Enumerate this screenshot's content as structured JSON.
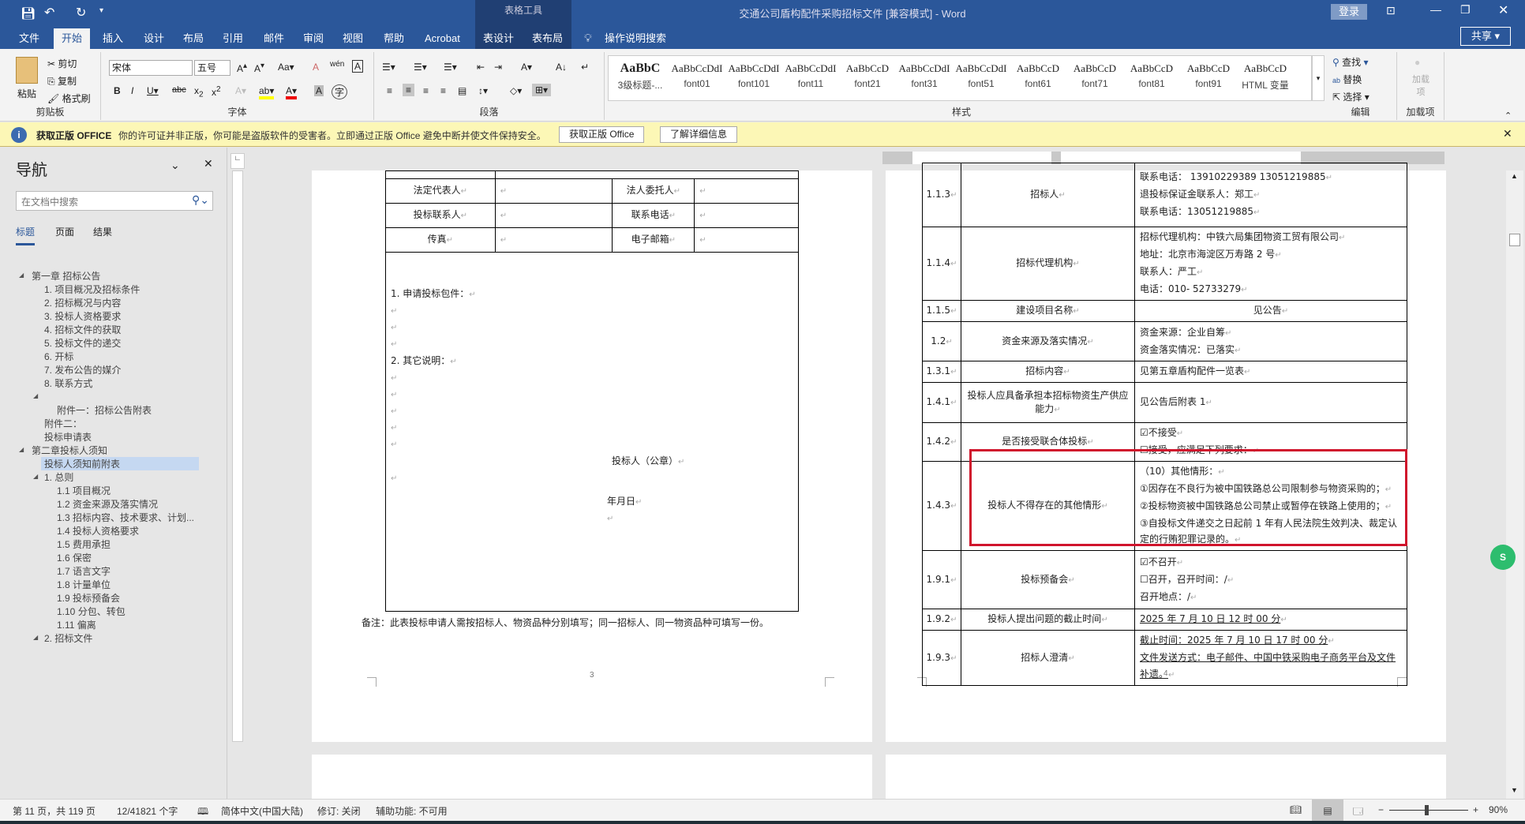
{
  "titlebar": {
    "title": "交通公司盾构配件采购招标文件 [兼容模式] - Word",
    "context_tab": "表格工具",
    "login": "登录",
    "share": "共享"
  },
  "tabs": [
    "文件",
    "开始",
    "插入",
    "设计",
    "布局",
    "引用",
    "邮件",
    "审阅",
    "视图",
    "帮助",
    "Acrobat",
    "表设计",
    "表布局"
  ],
  "tell_me": "操作说明搜索",
  "ribbon": {
    "clipboard": {
      "paste": "粘贴",
      "cut": "剪切",
      "copy": "复制",
      "format_painter": "格式刷",
      "label": "剪贴板"
    },
    "font": {
      "name": "宋体",
      "size": "五号",
      "label": "字体"
    },
    "paragraph": {
      "label": "段落"
    },
    "styles": {
      "label": "样式",
      "items": [
        {
          "preview": "AaBbC",
          "name": "3级标题-..."
        },
        {
          "preview": "AaBbCcDdI",
          "name": "font01"
        },
        {
          "preview": "AaBbCcDdI",
          "name": "font101"
        },
        {
          "preview": "AaBbCcDdI",
          "name": "font11"
        },
        {
          "preview": "AaBbCcD",
          "name": "font21"
        },
        {
          "preview": "AaBbCcDdI",
          "name": "font31"
        },
        {
          "preview": "AaBbCcDdI",
          "name": "font51"
        },
        {
          "preview": "AaBbCcD",
          "name": "font61"
        },
        {
          "preview": "AaBbCcD",
          "name": "font71"
        },
        {
          "preview": "AaBbCcD",
          "name": "font81"
        },
        {
          "preview": "AaBbCcD",
          "name": "font91"
        },
        {
          "preview": "AaBbCcD",
          "name": "HTML 变量"
        }
      ]
    },
    "editing": {
      "find": "查找",
      "replace": "替换",
      "select": "选择",
      "label": "编辑"
    },
    "addins": {
      "button": "加载项",
      "label": "加载项"
    }
  },
  "message_bar": {
    "title": "获取正版 OFFICE",
    "text": "你的许可证并非正版，你可能是盗版软件的受害者。立即通过正版 Office 避免中断并使文件保持安全。",
    "btn1": "获取正版 Office",
    "btn2": "了解详细信息"
  },
  "nav": {
    "title": "导航",
    "search_placeholder": "在文档中搜索",
    "tabs": [
      "标题",
      "页面",
      "结果"
    ],
    "items": [
      "第一章 招标公告",
      "1. 项目概况及招标条件",
      "2. 招标概况与内容",
      "3. 投标人资格要求",
      "4. 招标文件的获取",
      "5. 投标文件的递交",
      "6. 开标",
      "7. 发布公告的媒介",
      "8. 联系方式",
      "",
      "附件一：招标公告附表",
      "附件二：",
      "投标申请表",
      "第二章投标人须知",
      "投标人须知前附表",
      "1. 总则",
      "1.1 项目概况",
      "1.2 资金来源及落实情况",
      "1.3 招标内容、技术要求、计划...",
      "1.4 投标人资格要求",
      "1.5 费用承担",
      "1.6 保密",
      "1.7 语言文字",
      "1.8 计量单位",
      "1.9 投标预备会",
      "1.10 分包、转包",
      "1.11 偏离",
      "2. 招标文件"
    ]
  },
  "page1": {
    "rows": [
      [
        "法定代表人",
        "",
        "法人委托人",
        ""
      ],
      [
        "投标联系人",
        "",
        "联系电话",
        ""
      ],
      [
        "传真",
        "",
        "电子邮箱",
        ""
      ]
    ],
    "item1": "1. 申请投标包件：",
    "item2": "2. 其它说明：",
    "seal": "投标人（公章）",
    "date": "年月日",
    "note": "备注：此表投标申请人需按招标人、物资品种分别填写；同一招标人、同一物资品种可填写一份。",
    "page_no": "3"
  },
  "page2": {
    "rows": [
      {
        "no": "1.1.3",
        "name": "招标人",
        "lines": [
          "联系电话：  13910229389        13051219885",
          "退投标保证金联系人：郑工",
          "联系电话：13051219885"
        ]
      },
      {
        "no": "1.1.4",
        "name": "招标代理机构",
        "lines": [
          "招标代理机构：中铁六局集团物资工贸有限公司",
          "地址：北京市海淀区万寿路 2 号",
          "联系人：严工",
          "电话：010- 52733279"
        ]
      },
      {
        "no": "1.1.5",
        "name": "建设项目名称",
        "lines": [
          "见公告"
        ]
      },
      {
        "no": "1.2",
        "name": "资金来源及落实情况",
        "lines": [
          "资金来源：企业自筹",
          "资金落实情况：已落实"
        ]
      },
      {
        "no": "1.3.1",
        "name": "招标内容",
        "lines": [
          "见第五章盾构配件一览表"
        ]
      },
      {
        "no": "1.4.1",
        "name": "投标人应具备承担本招标物资生产供应能力",
        "lines": [
          "见公告后附表 1"
        ]
      },
      {
        "no": "1.4.2",
        "name": "是否接受联合体投标",
        "lines": [
          "☑不接受",
          "☐接受，应满足下列要求："
        ]
      },
      {
        "no": "1.4.3",
        "name": "投标人不得存在的其他情形",
        "lines": [
          "（10）其他情形：",
          "①因存在不良行为被中国铁路总公司限制参与物资采购的；",
          "②投标物资被中国铁路总公司禁止或暂停在铁路上使用的；",
          "③自投标文件递交之日起前 1 年有人民法院生效判决、裁定认定的行贿犯罪记录的。"
        ]
      },
      {
        "no": "1.9.1",
        "name": "投标预备会",
        "lines": [
          "☑不召开",
          "☐召开，召开时间：/",
          "召开地点：/"
        ]
      },
      {
        "no": "1.9.2",
        "name": "投标人提出问题的截止时间",
        "lines": [
          "2025 年 7 月 10 日  12 时 00 分"
        ]
      },
      {
        "no": "1.9.3",
        "name": "招标人澄清",
        "lines": [
          "截止时间：2025 年 7 月 10 日  17 时 00 分",
          "文件发送方式：电子邮件、中国中铁采购电子商务平台及文件补遗。"
        ]
      }
    ],
    "page_no": "4",
    "highlight_color": "#d0142c"
  },
  "status": {
    "page": "第 11 页，共 119 页",
    "words": "12/41821 个字",
    "language": "简体中文(中国大陆)",
    "track": "修订: 关闭",
    "accessibility": "辅助功能: 不可用",
    "zoom": "90%",
    "zoom_level": 90
  },
  "colors": {
    "brand": "#2b579a",
    "message_bar": "#fcf7b6"
  }
}
